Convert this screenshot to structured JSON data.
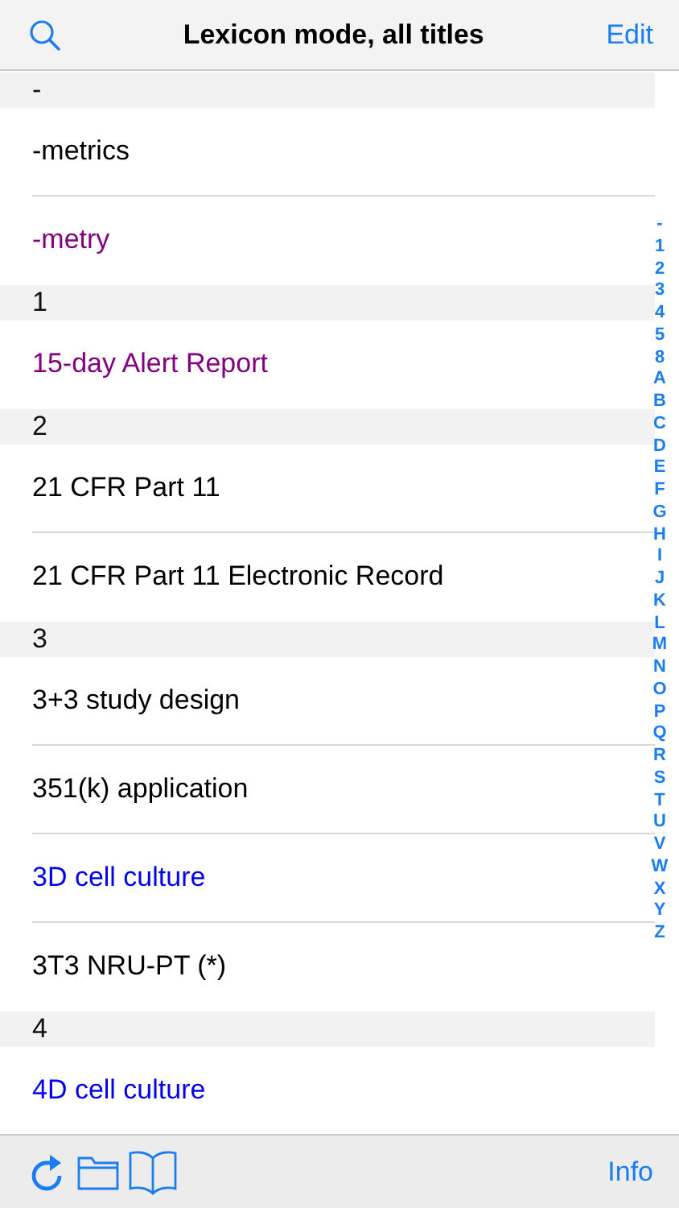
{
  "nav": {
    "title": "Lexicon mode, all titles",
    "right_button": "Edit"
  },
  "sections": [
    {
      "header": "-",
      "items": [
        {
          "label": "-metrics",
          "color": "#000000"
        },
        {
          "label": "-metry",
          "color": "#800080"
        }
      ]
    },
    {
      "header": "1",
      "items": [
        {
          "label": "15-day Alert Report",
          "color": "#800080"
        }
      ]
    },
    {
      "header": "2",
      "items": [
        {
          "label": "21 CFR Part 11",
          "color": "#000000"
        },
        {
          "label": "21 CFR Part 11 Electronic Record",
          "color": "#000000"
        }
      ]
    },
    {
      "header": "3",
      "items": [
        {
          "label": "3+3 study design",
          "color": "#000000"
        },
        {
          "label": "351(k) application",
          "color": "#000000"
        },
        {
          "label": "3D cell culture",
          "color": "#0000ee"
        },
        {
          "label": "3T3 NRU-PT (*)",
          "color": "#000000"
        }
      ]
    },
    {
      "header": "4",
      "items": [
        {
          "label": "4D cell culture",
          "color": "#0000ee"
        }
      ]
    }
  ],
  "index": [
    "-",
    "1",
    "2",
    "3",
    "4",
    "5",
    "8",
    "A",
    "B",
    "C",
    "D",
    "E",
    "F",
    "G",
    "H",
    "I",
    "J",
    "K",
    "L",
    "M",
    "N",
    "O",
    "P",
    "Q",
    "R",
    "S",
    "T",
    "U",
    "V",
    "W",
    "X",
    "Y",
    "Z"
  ],
  "toolbar": {
    "right_button": "Info"
  }
}
